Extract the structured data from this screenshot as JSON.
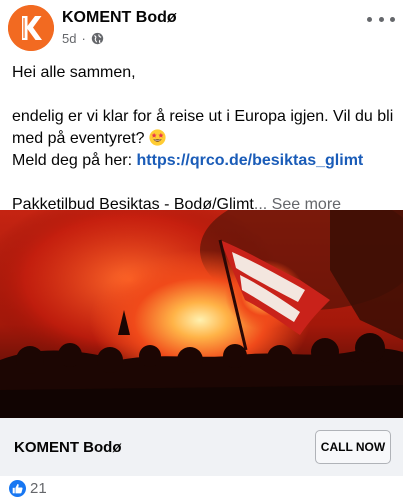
{
  "post": {
    "page_name": "KOMENT Bodø",
    "timestamp": "5d",
    "separator": "·",
    "privacy_icon": "globe-icon",
    "more_icon": "more-dots-icon",
    "greeting": "Hei alle sammen,",
    "body_line": "endelig er vi klar for å reise ut i Europa igjen. Vil du bli med på eventyret?",
    "emoji": "star-struck-emoji",
    "signup_prefix": "Meld deg på her: ",
    "signup_link": "https://qrco.de/besiktas_glimt",
    "teaser": "Pakketilbud Besiktas - Bodø/Glimt",
    "ellipsis": "...",
    "see_more": "See more"
  },
  "cta": {
    "title": "KOMENT Bodø",
    "button_label": "CALL NOW"
  },
  "reactions": {
    "icon": "like-icon",
    "count": "21"
  },
  "colors": {
    "brand_orange": "#f26a21",
    "link_blue": "#1a5cb8",
    "like_blue": "#1877f2",
    "meta_gray": "#65676b",
    "cta_background": "#f0f2f5"
  }
}
